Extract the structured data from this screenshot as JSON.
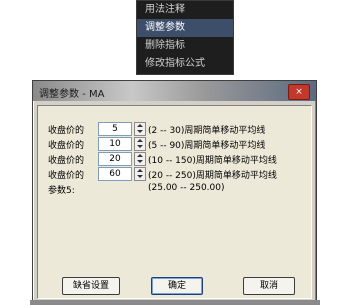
{
  "context_menu": {
    "items": [
      {
        "label": "用法注释"
      },
      {
        "label": "调整参数"
      },
      {
        "label": "删除指标"
      },
      {
        "label": "修改指标公式"
      }
    ]
  },
  "dialog": {
    "title": "调整参数 - MA",
    "close_glyph": "×",
    "params": [
      {
        "label": "收盘价的",
        "value": "5",
        "desc": "(2 -- 30)周期简单移动平均线"
      },
      {
        "label": "收盘价的",
        "value": "10",
        "desc": "(5 -- 90)周期简单移动平均线"
      },
      {
        "label": "收盘价的",
        "value": "20",
        "desc": "(10 -- 150)周期简单移动平均线"
      },
      {
        "label": "收盘价的",
        "value": "60",
        "desc": "(20 -- 250)周期简单移动平均线"
      }
    ],
    "param5": {
      "label": "参数5:",
      "range": "(25.00 -- 250.00)"
    },
    "buttons": {
      "default": "缺省设置",
      "ok": "确定",
      "cancel": "取消"
    }
  }
}
